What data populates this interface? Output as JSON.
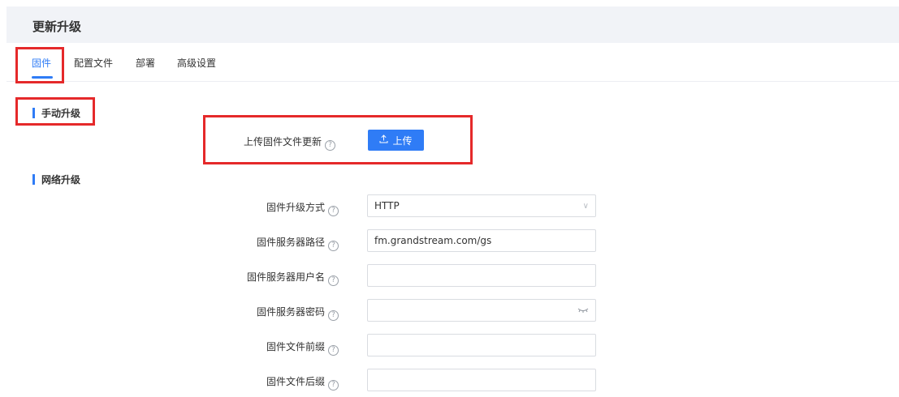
{
  "page": {
    "title": "更新升级"
  },
  "tabs": [
    {
      "label": "固件",
      "active": true
    },
    {
      "label": "配置文件",
      "active": false
    },
    {
      "label": "部署",
      "active": false
    },
    {
      "label": "高级设置",
      "active": false
    }
  ],
  "manual": {
    "section_title": "手动升级",
    "upload_label": "上传固件文件更新",
    "upload_button": "上传"
  },
  "network": {
    "section_title": "网络升级",
    "fields": [
      {
        "label": "固件升级方式",
        "value": "HTTP",
        "type": "select"
      },
      {
        "label": "固件服务器路径",
        "value": "fm.grandstream.com/gs",
        "type": "text"
      },
      {
        "label": "固件服务器用户名",
        "value": "",
        "type": "text"
      },
      {
        "label": "固件服务器密码",
        "value": "",
        "type": "password"
      },
      {
        "label": "固件文件前缀",
        "value": "",
        "type": "text"
      },
      {
        "label": "固件文件后缀",
        "value": "",
        "type": "text"
      }
    ]
  },
  "icons": {
    "help": "question-circle-icon",
    "upload": "upload-icon",
    "select": "chevron-down-icon",
    "password": "eye-closed-icon"
  },
  "colors": {
    "accent": "#2f7cf6",
    "callout": "#e5292a"
  }
}
